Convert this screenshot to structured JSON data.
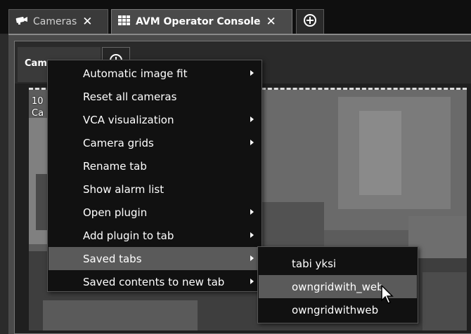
{
  "top_tabs": [
    {
      "label": "Cameras",
      "icon": "camera-icon",
      "close": "✕"
    },
    {
      "label": "AVM Operator Console",
      "icon": "grid-icon",
      "close": "✕"
    }
  ],
  "add_tab_icon": "plus-circle-icon",
  "inner_tab": {
    "label": "Cam"
  },
  "camera_overlay": {
    "line1": "10",
    "line2": "Ca"
  },
  "context_menu": {
    "items": [
      {
        "label": "Automatic image fit",
        "submenu": true
      },
      {
        "label": "Reset all cameras",
        "submenu": false
      },
      {
        "label": "VCA visualization",
        "submenu": true
      },
      {
        "label": "Camera grids",
        "submenu": true
      },
      {
        "label": "Rename tab",
        "submenu": false
      },
      {
        "label": "Show alarm list",
        "submenu": false
      },
      {
        "label": "Open plugin",
        "submenu": true
      },
      {
        "label": "Add plugin to tab",
        "submenu": true
      },
      {
        "label": "Saved tabs",
        "submenu": true
      },
      {
        "label": "Saved contents to new tab",
        "submenu": true
      }
    ]
  },
  "saved_tabs_submenu": {
    "items": [
      {
        "label": "tabi yksi"
      },
      {
        "label": "owngridwith_web"
      },
      {
        "label": "owngridwithweb"
      }
    ]
  },
  "colors": {
    "menu_bg": "#111111",
    "highlight": "#5a5a5a",
    "tabstrip_bg": "#0f0f0f"
  }
}
